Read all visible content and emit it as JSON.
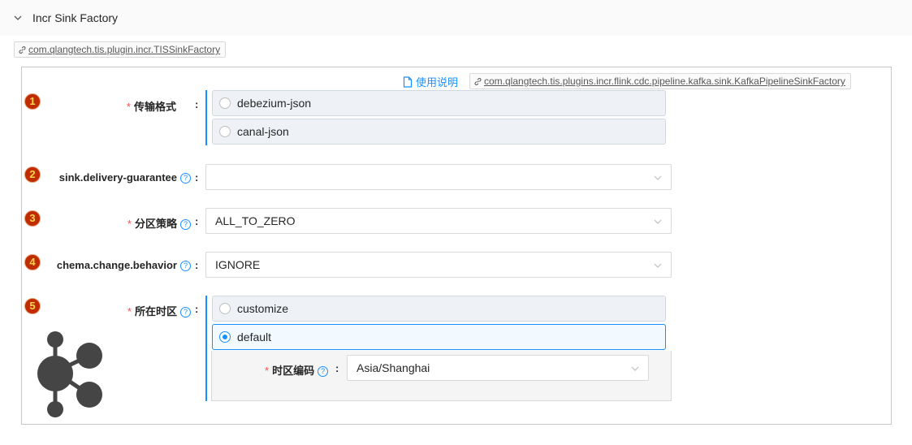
{
  "section": {
    "title": "Incr Sink Factory",
    "plugin_tag": "com.qlangtech.tis.plugin.incr.TISSinkFactory"
  },
  "panel": {
    "help_link": "使用说明",
    "impl_tag": "com.qlangtech.tis.plugins.incr.flink.cdc.pipeline.kafka.sink.KafkaPipelineSinkFactory",
    "fields": [
      {
        "index": "1",
        "label": "传输格式",
        "required": true,
        "type": "radio",
        "options": [
          "debezium-json",
          "canal-json"
        ],
        "selected": null
      },
      {
        "index": "2",
        "label": "sink.delivery-guarantee",
        "required": false,
        "has_help": true,
        "type": "select",
        "value": ""
      },
      {
        "index": "3",
        "label": "分区策略",
        "required": true,
        "has_help": true,
        "type": "select",
        "value": "ALL_TO_ZERO"
      },
      {
        "index": "4",
        "label": "chema.change.behavior",
        "required": false,
        "has_help": true,
        "type": "select",
        "value": "IGNORE"
      },
      {
        "index": "5",
        "label": "所在时区",
        "required": true,
        "has_help": true,
        "type": "radio",
        "options": [
          "customize",
          "default"
        ],
        "selected": "default",
        "sub_field": {
          "label": "时区编码",
          "required": true,
          "has_help": true,
          "value": "Asia/Shanghai"
        }
      }
    ]
  },
  "colors": {
    "accent": "#1890ff",
    "required": "#ff4d4f",
    "badge_bg": "#c02b00",
    "badge_text": "#ffd84a"
  },
  "icons": {
    "header": "chevron-down-icon",
    "tag": "link-icon",
    "help": "document-icon",
    "logo": "node-graph-logo-icon",
    "select": "chevron-down-icon",
    "field_help": "question-circle-icon"
  }
}
